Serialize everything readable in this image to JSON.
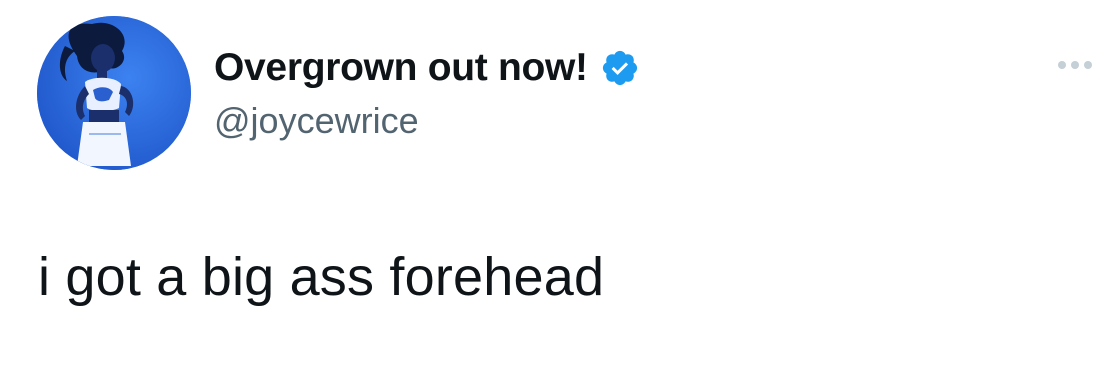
{
  "tweet": {
    "author": {
      "display_name": "Overgrown out now!",
      "handle": "@joycewrice",
      "verified": true,
      "avatar_icon": "profile-photo"
    },
    "text": "i got a big ass forehead",
    "more_icon": "more-options-icon"
  },
  "colors": {
    "text_primary": "#0f1419",
    "text_secondary": "#536471",
    "verified_blue": "#1d9bf0",
    "avatar_bg": "#2f6fe6",
    "more_dots": "#c4cfd6"
  }
}
